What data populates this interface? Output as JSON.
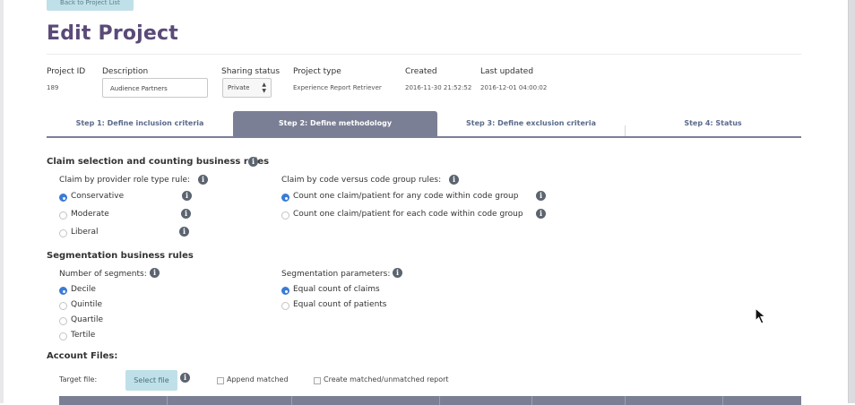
{
  "header": {
    "back_button": "Back to Project List",
    "title": "Edit Project"
  },
  "project": {
    "id_label": "Project ID",
    "id_value": "189",
    "description_label": "Description",
    "description_value": "Audience Partners",
    "sharing_label": "Sharing status",
    "sharing_value": "Private",
    "type_label": "Project type",
    "type_value": "Experience Report Retriever",
    "created_label": "Created",
    "created_value": "2016-11-30 21:52:52",
    "updated_label": "Last updated",
    "updated_value": "2016-12-01 04:00:02"
  },
  "tabs": [
    {
      "label": "Step 1: Define inclusion criteria",
      "active": false
    },
    {
      "label": "Step 2: Define methodology",
      "active": true
    },
    {
      "label": "Step 3: Define exclusion criteria",
      "active": false
    },
    {
      "label": "Step 4: Status",
      "active": false
    }
  ],
  "claim_section": {
    "title": "Claim selection and counting business rules",
    "role_rule_label": "Claim by provider role type rule:",
    "role_options": [
      {
        "label": "Conservative",
        "selected": true
      },
      {
        "label": "Moderate",
        "selected": false
      },
      {
        "label": "Liberal",
        "selected": false
      }
    ],
    "code_rule_label": "Claim by code versus code group rules:",
    "code_options": [
      {
        "label": "Count one claim/patient for any code within code group",
        "selected": true
      },
      {
        "label": "Count one claim/patient for each code within code group",
        "selected": false
      }
    ]
  },
  "segmentation": {
    "title": "Segmentation business rules",
    "segments_label": "Number of segments:",
    "segment_options": [
      {
        "label": "Decile",
        "selected": true
      },
      {
        "label": "Quintile",
        "selected": false
      },
      {
        "label": "Quartile",
        "selected": false
      },
      {
        "label": "Tertile",
        "selected": false
      }
    ],
    "params_label": "Segmentation parameters:",
    "param_options": [
      {
        "label": "Equal count of claims",
        "selected": true
      },
      {
        "label": "Equal count of patients",
        "selected": false
      }
    ]
  },
  "account_files": {
    "title": "Account Files:",
    "target_label": "Target file:",
    "select_file_button": "Select file",
    "append_matched_label": "Append matched",
    "create_report_label": "Create matched/unmatched report"
  },
  "colors": {
    "title": "#5a4a78",
    "tab_active": "#7a7f95",
    "button_bg": "#bfe0e8",
    "radio_selected": "#3a7bd5"
  },
  "icons": {
    "info": "info-circle-icon",
    "sort": "updown-arrows-icon",
    "cursor": "mouse-pointer-icon"
  }
}
